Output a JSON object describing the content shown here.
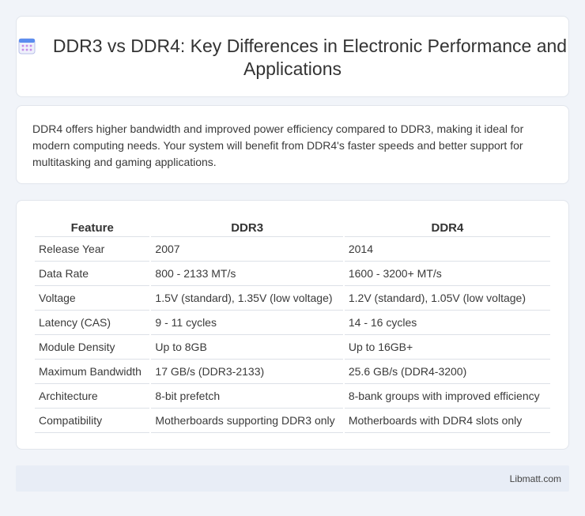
{
  "header": {
    "icon": "calendar-icon",
    "title": "DDR3 vs DDR4: Key Differences in Electronic Performance and Applications"
  },
  "summary": {
    "text": "DDR4 offers higher bandwidth and improved power efficiency compared to DDR3, making it ideal for modern computing needs. Your system will benefit from DDR4's faster speeds and better support for multitasking and gaming applications."
  },
  "table": {
    "headers": [
      "Feature",
      "DDR3",
      "DDR4"
    ],
    "rows": [
      [
        "Release Year",
        "2007",
        "2014"
      ],
      [
        "Data Rate",
        "800 - 2133 MT/s",
        "1600 - 3200+ MT/s"
      ],
      [
        "Voltage",
        "1.5V (standard), 1.35V (low voltage)",
        "1.2V (standard), 1.05V (low voltage)"
      ],
      [
        "Latency (CAS)",
        "9 - 11 cycles",
        "14 - 16 cycles"
      ],
      [
        "Module Density",
        "Up to 8GB",
        "Up to 16GB+"
      ],
      [
        "Maximum Bandwidth",
        "17 GB/s (DDR3-2133)",
        "25.6 GB/s (DDR4-3200)"
      ],
      [
        "Architecture",
        "8-bit prefetch",
        "8-bank groups with improved efficiency"
      ],
      [
        "Compatibility",
        "Motherboards supporting DDR3 only",
        "Motherboards with DDR4 slots only"
      ]
    ]
  },
  "footer": {
    "brand": "Libmatt.com"
  }
}
